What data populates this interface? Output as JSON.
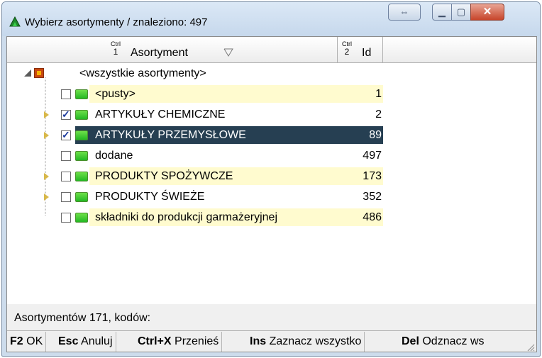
{
  "window": {
    "title": "Wybierz asortymenty / znaleziono: 497"
  },
  "colors": {
    "selected_row": "#263f52",
    "band_yellow": "#fffbcf",
    "folder_green": "#23b823"
  },
  "header": {
    "asortyment": {
      "ctrl": "Ctrl",
      "num": "1",
      "label": "Asortyment"
    },
    "id": {
      "ctrl": "Ctrl",
      "num": "2",
      "label": "Id"
    }
  },
  "tree": {
    "root_label": "<wszystkie asortymenty>",
    "rows": [
      {
        "label": "<pusty>",
        "id": "1",
        "checked": false,
        "expandable": false,
        "band": "yellow",
        "selected": false
      },
      {
        "label": "ARTYKUŁY CHEMICZNE",
        "id": "2",
        "checked": true,
        "expandable": true,
        "band": "none",
        "selected": false
      },
      {
        "label": "ARTYKUŁY PRZEMYSŁOWE",
        "id": "89",
        "checked": true,
        "expandable": true,
        "band": "sel",
        "selected": true
      },
      {
        "label": "dodane",
        "id": "497",
        "checked": false,
        "expandable": false,
        "band": "none",
        "selected": false
      },
      {
        "label": "PRODUKTY SPOŻYWCZE",
        "id": "173",
        "checked": false,
        "expandable": true,
        "band": "yellow",
        "selected": false
      },
      {
        "label": "PRODUKTY ŚWIEŻE",
        "id": "352",
        "checked": false,
        "expandable": true,
        "band": "none",
        "selected": false
      },
      {
        "label": "składniki do produkcji garmażeryjnej",
        "id": "486",
        "checked": false,
        "expandable": false,
        "band": "yellow",
        "selected": false
      }
    ]
  },
  "status": {
    "text": "Asortymentów 171, kodów:"
  },
  "toolbar": {
    "buttons": [
      {
        "key": "F2",
        "label": "OK"
      },
      {
        "key": "Esc",
        "label": "Anuluj"
      },
      {
        "key": "Ctrl+X",
        "label": "Przenieś"
      },
      {
        "key": "Ins",
        "label": "Zaznacz wszystko"
      },
      {
        "key": "Del",
        "label": "Odznacz ws"
      }
    ]
  }
}
